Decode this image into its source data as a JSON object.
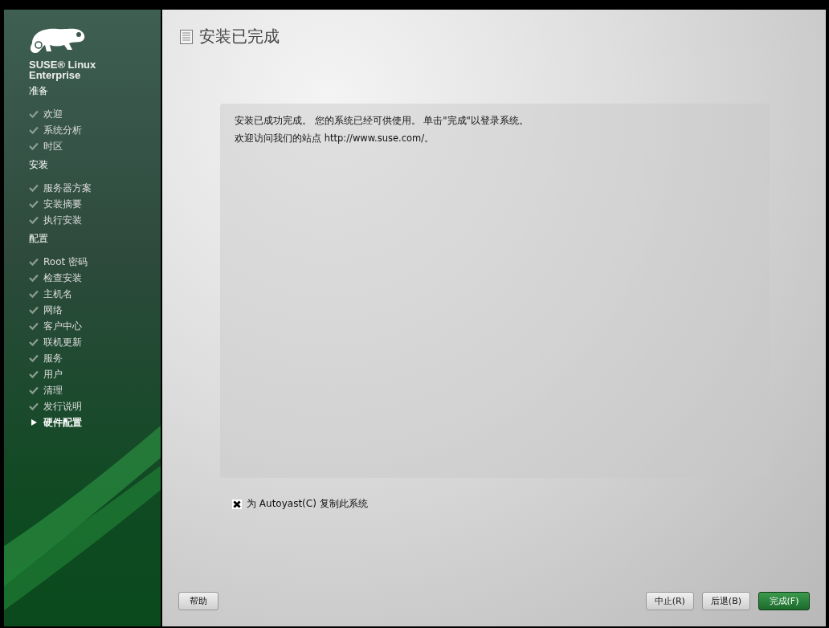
{
  "logo": {
    "lines": [
      "SUSE® Linux",
      "Enterprise"
    ]
  },
  "steps": [
    {
      "heading": "准备",
      "items": [
        {
          "label": "欢迎",
          "kind": "done"
        },
        {
          "label": "系统分析",
          "kind": "done"
        },
        {
          "label": "时区",
          "kind": "done"
        }
      ]
    },
    {
      "heading": "安装",
      "items": [
        {
          "label": "服务器方案",
          "kind": "done"
        },
        {
          "label": "安装摘要",
          "kind": "done"
        },
        {
          "label": "执行安装",
          "kind": "done"
        }
      ]
    },
    {
      "heading": "配置",
      "items": [
        {
          "label": "Root 密码",
          "kind": "done"
        },
        {
          "label": "检查安装",
          "kind": "done"
        },
        {
          "label": "主机名",
          "kind": "done"
        },
        {
          "label": "网络",
          "kind": "done"
        },
        {
          "label": "客户中心",
          "kind": "done"
        },
        {
          "label": "联机更新",
          "kind": "done"
        },
        {
          "label": "服务",
          "kind": "done"
        },
        {
          "label": "用户",
          "kind": "done"
        },
        {
          "label": "清理",
          "kind": "done"
        },
        {
          "label": "发行说明",
          "kind": "done"
        },
        {
          "label": "硬件配置",
          "kind": "current"
        }
      ]
    }
  ],
  "title": "安装已完成",
  "message": [
    "安装已成功完成。 您的系统已经可供使用。 单击\"完成\"以登录系统。",
    "欢迎访问我们的站点 http://www.suse.com/。"
  ],
  "clone_option": {
    "label": "为 Autoyast(C) 复制此系统",
    "checked": true
  },
  "buttons": {
    "help": "帮助",
    "actions": [
      {
        "label": "中止(R)",
        "primary": false
      },
      {
        "label": "后退(B)",
        "primary": false
      },
      {
        "label": "完成(F)",
        "primary": true
      }
    ]
  }
}
